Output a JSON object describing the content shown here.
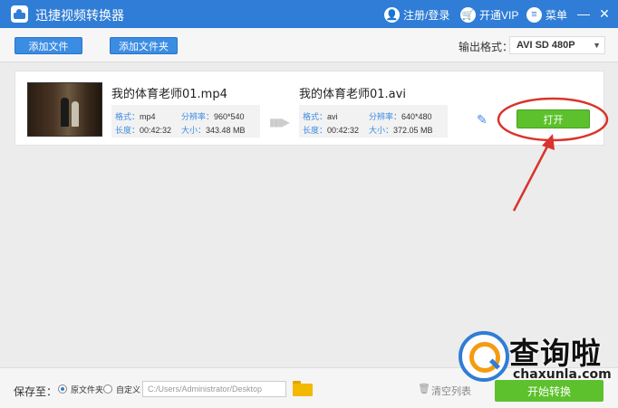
{
  "titlebar": {
    "app_title": "迅捷视频转换器",
    "login_label": "注册/登录",
    "vip_label": "开通VIP",
    "menu_label": "菜单",
    "minimize": "—",
    "close": "✕"
  },
  "toolbar": {
    "add_file_label": "添加文件",
    "add_folder_label": "添加文件夹",
    "output_format_label": "输出格式：",
    "output_format_value": "AVI  SD 480P"
  },
  "task": {
    "source": {
      "filename": "我的体育老师01.mp4",
      "format_key": "格式：",
      "format_value": "mp4",
      "resolution_key": "分辨率：",
      "resolution_value": "960*540",
      "duration_key": "长度：",
      "duration_value": "00:42:32",
      "size_key": "大小：",
      "size_value": "343.48 MB"
    },
    "target": {
      "filename": "我的体育老师01.avi",
      "format_key": "格式：",
      "format_value": "avi",
      "resolution_key": "分辨率：",
      "resolution_value": "640*480",
      "duration_key": "长度：",
      "duration_value": "00:42:32",
      "size_key": "大小：",
      "size_value": "372.05 MB"
    },
    "open_label": "打开"
  },
  "bottombar": {
    "save_to_label": "保存至：",
    "radio_original": "原文件夹",
    "radio_custom": "自定义",
    "path_value": "C:/Users/Administrator/Desktop",
    "clear_label": "清空列表",
    "start_label": "开始转换"
  },
  "watermark": {
    "cn_text": "查询啦",
    "en_text": "chaxunla.com"
  },
  "colors": {
    "primary": "#2f7dd6",
    "button_blue": "#3b8ce3",
    "open_green": "#5cc12c",
    "annotation_red": "#d9342b"
  }
}
